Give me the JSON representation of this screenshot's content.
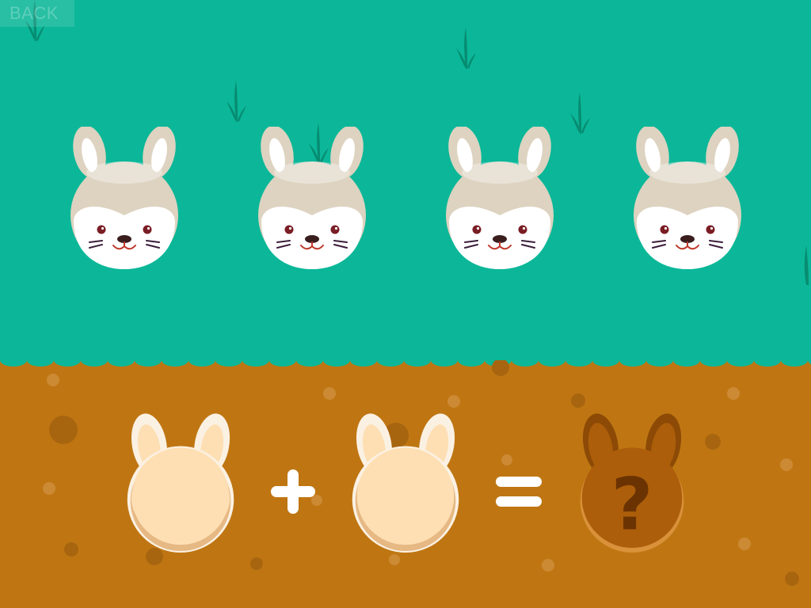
{
  "screen": {
    "back_label": "BACK",
    "answer_glyph": "?"
  },
  "bunnies": [
    {
      "name": "bunny-1"
    },
    {
      "name": "bunny-2"
    },
    {
      "name": "bunny-3"
    },
    {
      "name": "bunny-4"
    }
  ],
  "equation": {
    "left_slot": "bunny-head-slot-left",
    "operator": "plus",
    "right_slot": "bunny-head-slot-right",
    "equals": "equals",
    "answer": "question-mark"
  },
  "colors": {
    "grass": "#0bb798",
    "dirt": "#bf7612",
    "grass_blade": "#078c72",
    "bunny_fur": "#ddd3c0",
    "bunny_face": "#ffffff",
    "slot_fill": "#fddfb3",
    "answer_fill": "#ad5e0a",
    "answer_mark": "#6b3302"
  }
}
